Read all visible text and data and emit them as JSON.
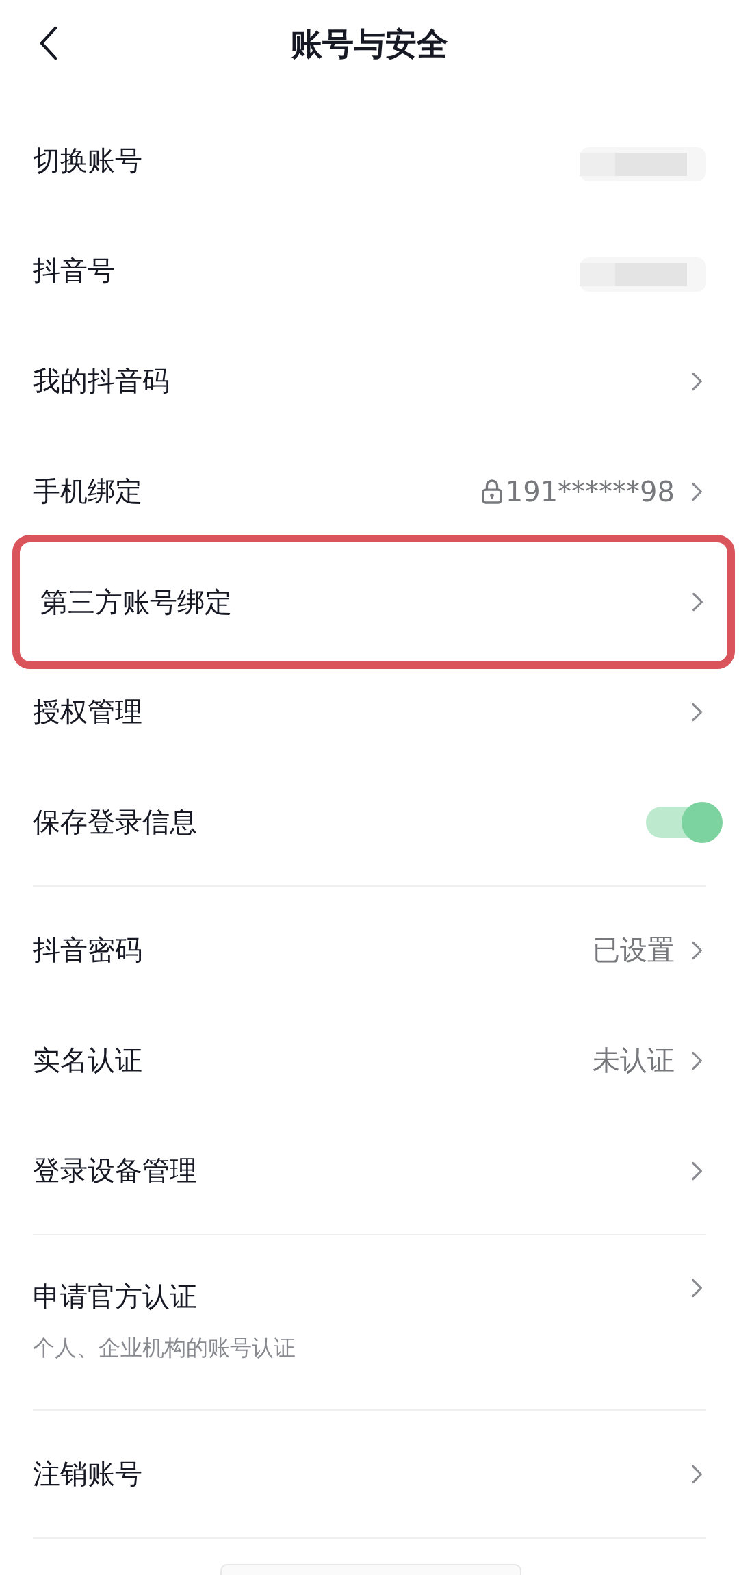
{
  "header": {
    "title": "账号与安全"
  },
  "sections": [
    {
      "items": [
        {
          "kind": "blurred",
          "label": "切换账号",
          "highlighted": false
        },
        {
          "kind": "blurred",
          "label": "抖音号",
          "highlighted": false
        },
        {
          "kind": "link",
          "label": "我的抖音码",
          "highlighted": false
        },
        {
          "kind": "link",
          "label": "手机绑定",
          "value": "191******98",
          "locked": true,
          "highlighted": false
        },
        {
          "kind": "link",
          "label": "第三方账号绑定",
          "highlighted": true
        },
        {
          "kind": "link",
          "label": "授权管理",
          "highlighted": false
        },
        {
          "kind": "toggle",
          "label": "保存登录信息",
          "on": true,
          "highlighted": false
        }
      ]
    },
    {
      "items": [
        {
          "kind": "link",
          "label": "抖音密码",
          "value": "已设置",
          "highlighted": false
        },
        {
          "kind": "link",
          "label": "实名认证",
          "value": "未认证",
          "highlighted": false
        },
        {
          "kind": "link",
          "label": "登录设备管理",
          "highlighted": false
        }
      ]
    },
    {
      "items": [
        {
          "kind": "link",
          "label": "申请官方认证",
          "sublabel": "个人、企业机构的账号认证",
          "highlighted": false
        }
      ]
    },
    {
      "items": [
        {
          "kind": "link",
          "label": "注销账号",
          "highlighted": false
        }
      ]
    }
  ]
}
